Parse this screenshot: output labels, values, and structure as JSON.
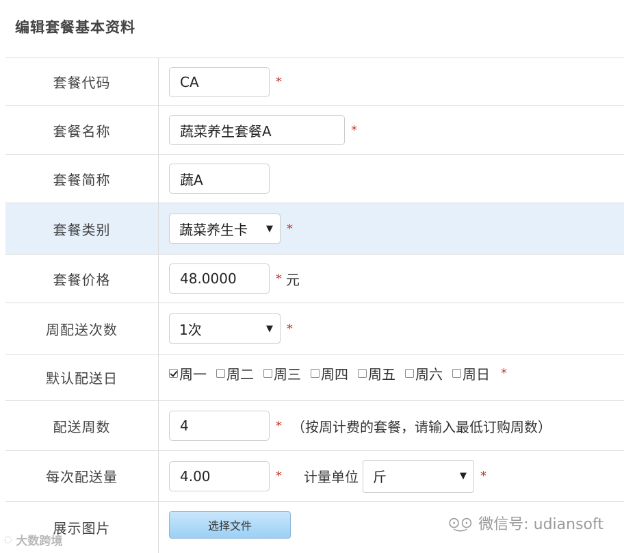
{
  "page_title": "编辑套餐基本资料",
  "required_mark": "*",
  "fields": {
    "code": {
      "label": "套餐代码",
      "value": "CA"
    },
    "name": {
      "label": "套餐名称",
      "value": "蔬菜养生套餐A"
    },
    "short_name": {
      "label": "套餐简称",
      "value": "蔬A"
    },
    "category": {
      "label": "套餐类别",
      "selected": "蔬菜养生卡"
    },
    "price": {
      "label": "套餐价格",
      "value": "48.0000",
      "suffix": "元"
    },
    "weekly_deliveries": {
      "label": "周配送次数",
      "selected": "1次"
    },
    "default_days": {
      "label": "默认配送日",
      "days": [
        {
          "label": "周一",
          "checked": true
        },
        {
          "label": "周二",
          "checked": false
        },
        {
          "label": "周三",
          "checked": false
        },
        {
          "label": "周四",
          "checked": false
        },
        {
          "label": "周五",
          "checked": false
        },
        {
          "label": "周六",
          "checked": false
        },
        {
          "label": "周日",
          "checked": false
        }
      ]
    },
    "weeks": {
      "label": "配送周数",
      "value": "4",
      "note": "（按周计费的套餐，请输入最低订购周数）"
    },
    "quantity": {
      "label": "每次配送量",
      "value": "4.00",
      "unit_label": "计量单位",
      "unit_selected": "斤"
    },
    "image": {
      "label": "展示图片",
      "button": "选择文件"
    }
  },
  "watermarks": {
    "right": "微信号: udiansoft",
    "left": "大数跨境"
  },
  "icons": {
    "select_caret": "triangle-down",
    "wechat": "wechat-icon"
  },
  "colors": {
    "highlight_row": "#e6f0fb",
    "required": "#c0392b",
    "file_button": "#9bd0f5"
  }
}
